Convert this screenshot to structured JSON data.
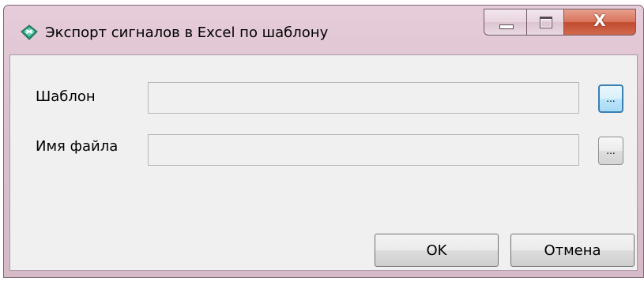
{
  "window": {
    "title": "Экспорт сигналов в Excel по шаблону",
    "icon": "excel-export-icon",
    "controls": {
      "minimize": "minimize-icon",
      "maximize": "maximize-icon",
      "close_glyph": "X"
    }
  },
  "form": {
    "template": {
      "label": "Шаблон",
      "value": "",
      "browse_label": "..."
    },
    "filename": {
      "label": "Имя файла",
      "value": "",
      "browse_label": "..."
    }
  },
  "buttons": {
    "ok": "OK",
    "cancel": "Отмена"
  },
  "colors": {
    "accent": "#3c7fb1",
    "titlebar": "#dcc0ce",
    "close_button": "#c24b2f"
  }
}
